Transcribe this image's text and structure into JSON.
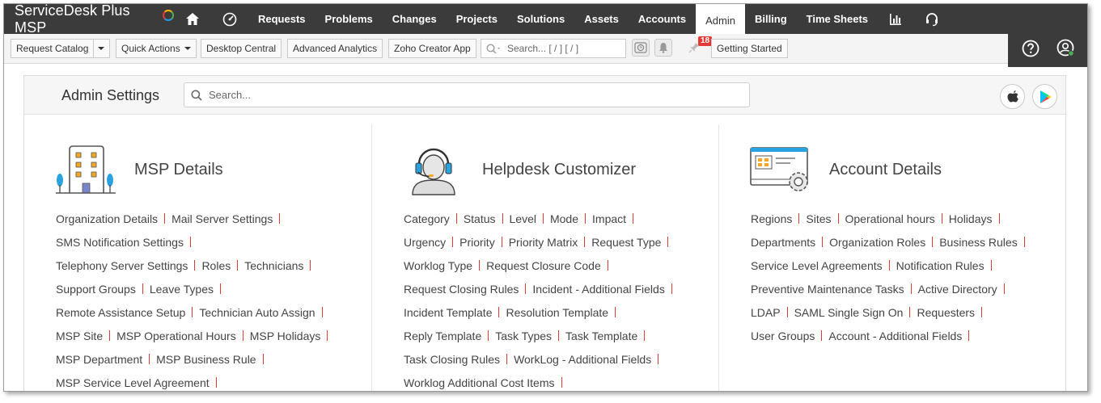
{
  "brand": {
    "name": "ServiceDesk Plus MSP"
  },
  "nav": {
    "items": [
      "Requests",
      "Problems",
      "Changes",
      "Projects",
      "Solutions",
      "Assets",
      "Accounts",
      "Admin",
      "Billing",
      "Time Sheets"
    ],
    "active": "Admin"
  },
  "toolbar": {
    "request_catalog": "Request Catalog",
    "quick_actions": "Quick Actions",
    "desktop_central": "Desktop Central",
    "advanced_analytics": "Advanced Analytics",
    "zoho_creator": "Zoho Creator App",
    "search_placeholder": "Search... [ / ] [ / ]",
    "announcement_count": "18",
    "getting_started": "Getting Started"
  },
  "admin": {
    "title": "Admin Settings",
    "search_placeholder": "Search..."
  },
  "sections": [
    {
      "title": "MSP Details",
      "icon": "building-icon",
      "rows": [
        [
          "Organization Details",
          "Mail Server Settings"
        ],
        [
          "SMS Notification Settings"
        ],
        [
          "Telephony Server Settings",
          "Roles",
          "Technicians"
        ],
        [
          "Support Groups",
          "Leave Types"
        ],
        [
          "Remote Assistance Setup",
          "Technician Auto Assign"
        ],
        [
          "MSP Site",
          "MSP Operational Hours",
          "MSP Holidays"
        ],
        [
          "MSP Department",
          "MSP Business Rule"
        ],
        [
          "MSP Service Level Agreement"
        ]
      ]
    },
    {
      "title": "Helpdesk Customizer",
      "icon": "headset-agent-icon",
      "rows": [
        [
          "Category",
          "Status",
          "Level",
          "Mode",
          "Impact"
        ],
        [
          "Urgency",
          "Priority",
          "Priority Matrix",
          "Request Type"
        ],
        [
          "Worklog Type",
          "Request Closure Code"
        ],
        [
          "Request Closing Rules",
          "Incident - Additional Fields"
        ],
        [
          "Incident Template",
          "Resolution Template"
        ],
        [
          "Reply Template",
          "Task Types",
          "Task Template"
        ],
        [
          "Task Closing Rules",
          "WorkLog - Additional Fields"
        ],
        [
          "Worklog Additional Cost Items"
        ]
      ]
    },
    {
      "title": "Account Details",
      "icon": "account-settings-icon",
      "rows": [
        [
          "Regions",
          "Sites",
          "Operational hours",
          "Holidays"
        ],
        [
          "Departments",
          "Organization Roles",
          "Business Rules"
        ],
        [
          "Service Level Agreements",
          "Notification Rules"
        ],
        [
          "Preventive Maintenance Tasks",
          "Active Directory"
        ],
        [
          "LDAP",
          "SAML Single Sign On",
          "Requesters"
        ],
        [
          "User Groups",
          "Account - Additional Fields"
        ]
      ]
    }
  ]
}
